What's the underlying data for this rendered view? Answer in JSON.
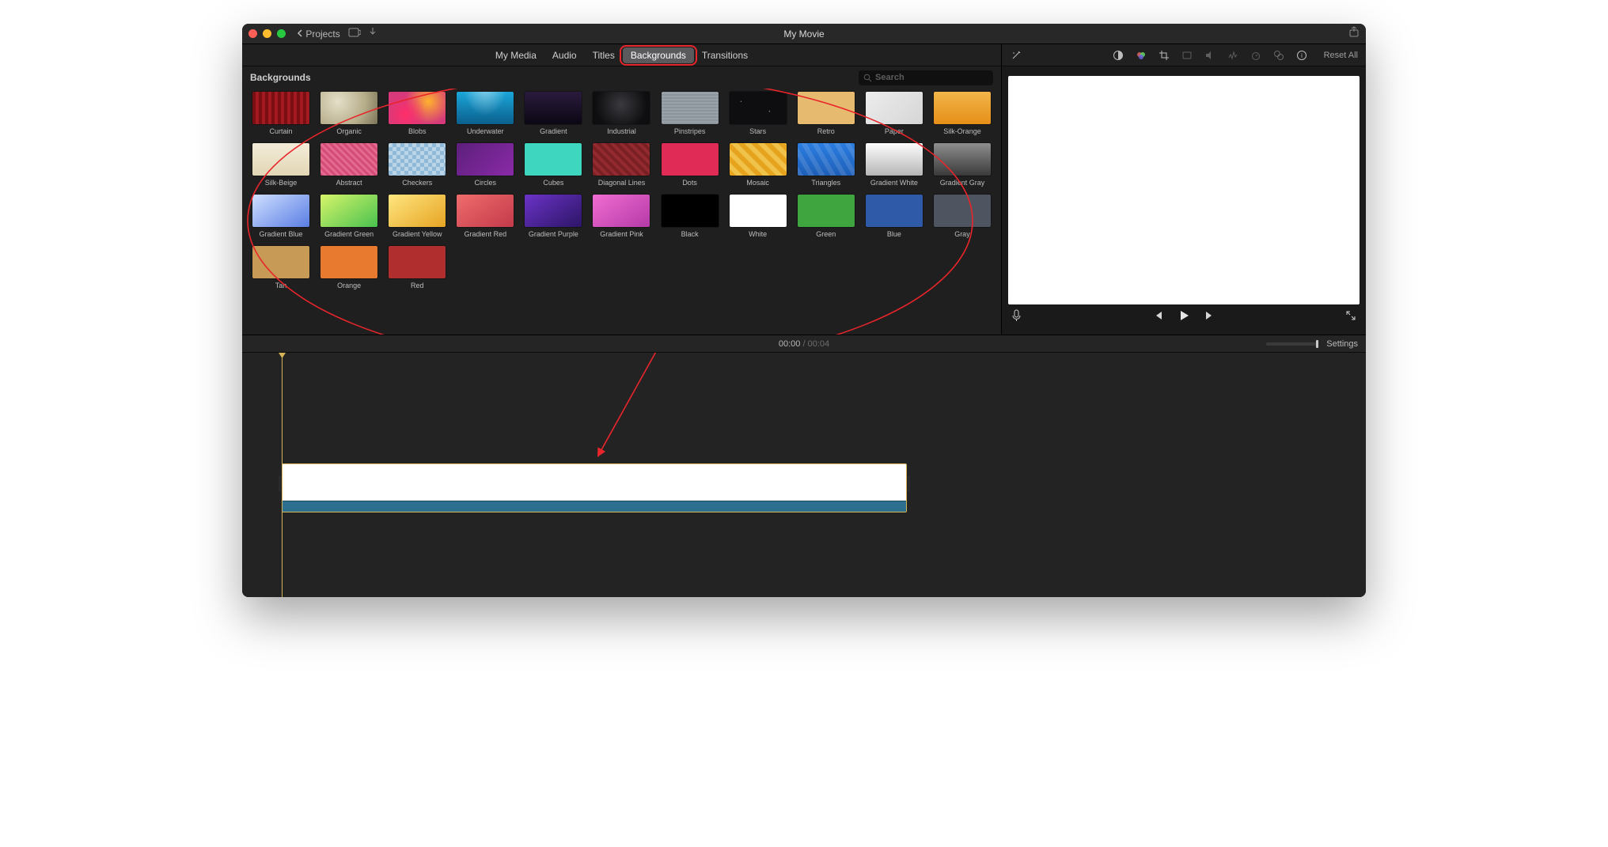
{
  "titlebar": {
    "projects": "Projects",
    "title": "My Movie"
  },
  "tabs": {
    "mymedia": "My Media",
    "audio": "Audio",
    "titles": "Titles",
    "backgrounds": "Backgrounds",
    "transitions": "Transitions"
  },
  "browser": {
    "heading": "Backgrounds",
    "search_placeholder": "Search"
  },
  "backgrounds": [
    {
      "id": "curtain",
      "label": "Curtain",
      "css": "bg-curtain"
    },
    {
      "id": "organic",
      "label": "Organic",
      "css": "bg-organic"
    },
    {
      "id": "blobs",
      "label": "Blobs",
      "css": "bg-blobs"
    },
    {
      "id": "underwater",
      "label": "Underwater",
      "css": "bg-underwater"
    },
    {
      "id": "gradient",
      "label": "Gradient",
      "css": "bg-gradient"
    },
    {
      "id": "industrial",
      "label": "Industrial",
      "css": "bg-industrial"
    },
    {
      "id": "pinstripes",
      "label": "Pinstripes",
      "css": "bg-pinstripes"
    },
    {
      "id": "stars",
      "label": "Stars",
      "css": "bg-stars"
    },
    {
      "id": "retro",
      "label": "Retro",
      "css": "bg-retro"
    },
    {
      "id": "paper",
      "label": "Paper",
      "css": "bg-paper"
    },
    {
      "id": "silk-orange",
      "label": "Silk-Orange",
      "css": "bg-silkorange"
    },
    {
      "id": "silk-beige",
      "label": "Silk-Beige",
      "css": "bg-silkbeige"
    },
    {
      "id": "abstract",
      "label": "Abstract",
      "css": "bg-abstract"
    },
    {
      "id": "checkers",
      "label": "Checkers",
      "css": "bg-checkers"
    },
    {
      "id": "circles",
      "label": "Circles",
      "css": "bg-circles"
    },
    {
      "id": "cubes",
      "label": "Cubes",
      "css": "bg-cubes"
    },
    {
      "id": "diagonal-lines",
      "label": "Diagonal Lines",
      "css": "bg-diaglines"
    },
    {
      "id": "dots",
      "label": "Dots",
      "css": "bg-dots"
    },
    {
      "id": "mosaic",
      "label": "Mosaic",
      "css": "bg-mosaic"
    },
    {
      "id": "triangles",
      "label": "Triangles",
      "css": "bg-triangles"
    },
    {
      "id": "gradient-white",
      "label": "Gradient White",
      "css": "bg-grwhite"
    },
    {
      "id": "gradient-gray",
      "label": "Gradient Gray",
      "css": "bg-grgray"
    },
    {
      "id": "gradient-blue",
      "label": "Gradient Blue",
      "css": "bg-grblue"
    },
    {
      "id": "gradient-green",
      "label": "Gradient Green",
      "css": "bg-grgreen"
    },
    {
      "id": "gradient-yellow",
      "label": "Gradient Yellow",
      "css": "bg-gryellow"
    },
    {
      "id": "gradient-red",
      "label": "Gradient Red",
      "css": "bg-grred"
    },
    {
      "id": "gradient-purple",
      "label": "Gradient Purple",
      "css": "bg-grpurple"
    },
    {
      "id": "gradient-pink",
      "label": "Gradient Pink",
      "css": "bg-grpink"
    },
    {
      "id": "black",
      "label": "Black",
      "css": "bg-black"
    },
    {
      "id": "white",
      "label": "White",
      "css": "bg-white"
    },
    {
      "id": "green",
      "label": "Green",
      "css": "bg-green"
    },
    {
      "id": "blue",
      "label": "Blue",
      "css": "bg-blue"
    },
    {
      "id": "gray",
      "label": "Gray",
      "css": "bg-gray"
    },
    {
      "id": "tan",
      "label": "Tan",
      "css": "bg-tan"
    },
    {
      "id": "orange",
      "label": "Orange",
      "css": "bg-orange"
    },
    {
      "id": "red",
      "label": "Red",
      "css": "bg-red"
    }
  ],
  "viewer": {
    "reset": "Reset All"
  },
  "time": {
    "current": "00:00",
    "sep": " / ",
    "total": "00:04",
    "settings": "Settings"
  }
}
